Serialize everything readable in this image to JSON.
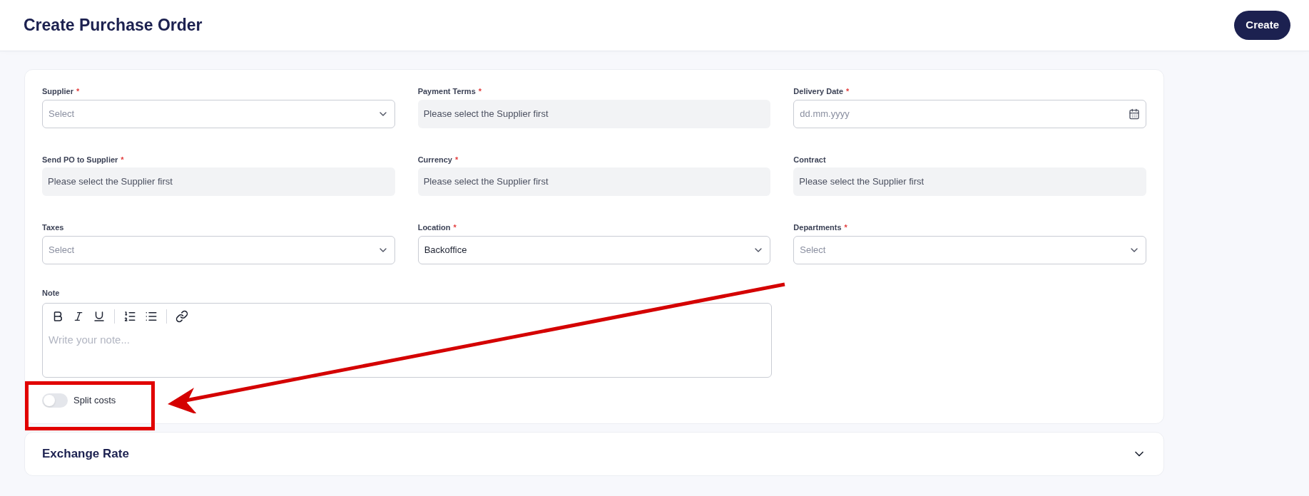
{
  "header": {
    "title": "Create Purchase Order",
    "create_button": "Create"
  },
  "fields": [
    {
      "label": "Supplier",
      "required": true,
      "kind": "select",
      "placeholder": "Select"
    },
    {
      "label": "Payment Terms",
      "required": true,
      "kind": "readonly",
      "value": "Please select the Supplier first"
    },
    {
      "label": "Delivery Date",
      "required": true,
      "kind": "date",
      "placeholder": "dd.mm.yyyy"
    },
    {
      "label": "Send PO to Supplier",
      "required": true,
      "kind": "readonly",
      "value": "Please select the Supplier first"
    },
    {
      "label": "Currency",
      "required": true,
      "kind": "readonly",
      "value": "Please select the Supplier first"
    },
    {
      "label": "Contract",
      "required": false,
      "kind": "readonly",
      "value": "Please select the Supplier first"
    },
    {
      "label": "Taxes",
      "required": false,
      "kind": "select",
      "placeholder": "Select"
    },
    {
      "label": "Location",
      "required": true,
      "kind": "select",
      "value": "Backoffice"
    },
    {
      "label": "Departments",
      "required": true,
      "kind": "select",
      "placeholder": "Select"
    }
  ],
  "required_mark": "*",
  "note": {
    "label": "Note",
    "placeholder": "Write your note..."
  },
  "split_costs": {
    "label": "Split costs",
    "on": false
  },
  "exchange_rate": {
    "title": "Exchange Rate",
    "expanded": false
  }
}
